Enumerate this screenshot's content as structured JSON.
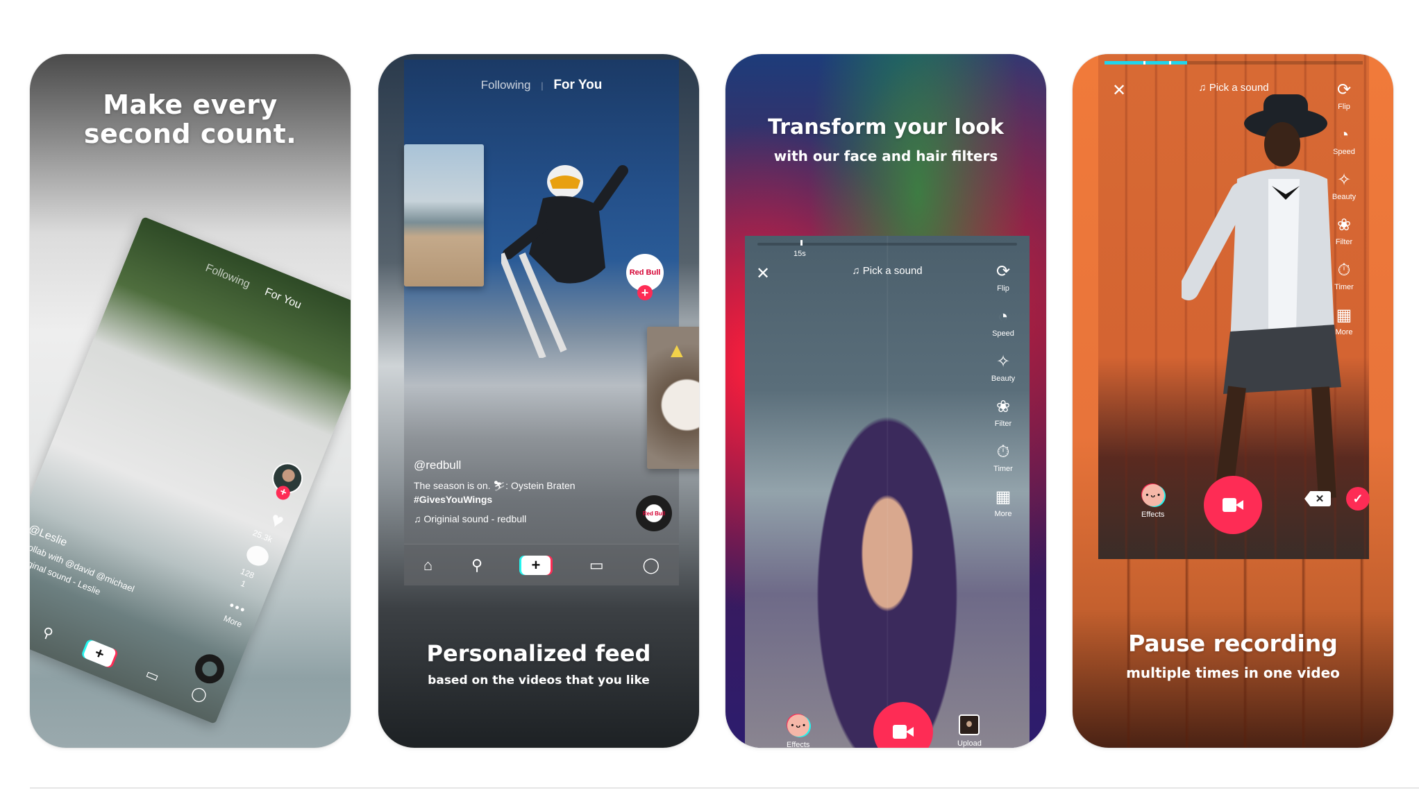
{
  "colors": {
    "accent_red": "#fe2c55",
    "accent_cyan": "#25f4ee",
    "progress_cyan": "#20d5ec",
    "divider": "#e5e5e5"
  },
  "screenshots": [
    {
      "headline": "Make every second count.",
      "headline_line1": "Make every",
      "headline_line2": "second count.",
      "card": {
        "tab_following": "Following",
        "tab_for_you": "For You",
        "like_count": "25.3k",
        "comment_count": "128",
        "share_count": "1",
        "more_label": "More",
        "username": "@Leslie",
        "description": "Collab with @david @michael",
        "sound": "Original sound - Leslie",
        "icons": [
          "home-icon",
          "search-icon",
          "create-icon",
          "inbox-icon",
          "profile-icon"
        ]
      }
    },
    {
      "headline": "Personalized feed",
      "subline": "based on the videos that you like",
      "feed": {
        "tab_following": "Following",
        "tab_separator": "|",
        "tab_for_you": "For You",
        "avatar_label": "Red Bull",
        "username": "@redbull",
        "description": "The season is on. ⛷: Oystein Braten",
        "hashtag": "#GivesYouWings",
        "sound": "Originial sound - redbull",
        "disc_label": "Red Bull",
        "icons": [
          "home-icon",
          "search-icon",
          "create-icon",
          "inbox-icon",
          "profile-icon"
        ]
      }
    },
    {
      "headline": "Transform your look",
      "subline": "with our face and hair filters",
      "camera": {
        "duration_label": "15s",
        "sound_label": "Pick a sound",
        "tools": [
          {
            "label": "Flip",
            "icon": "flip-icon",
            "glyph": "⟳"
          },
          {
            "label": "Speed",
            "icon": "speed-icon",
            "glyph": "◔"
          },
          {
            "label": "Beauty",
            "icon": "beauty-wand-icon",
            "glyph": "✧"
          },
          {
            "label": "Filter",
            "icon": "filter-icon",
            "glyph": "❀"
          },
          {
            "label": "Timer",
            "icon": "timer-icon",
            "glyph": "⏱"
          },
          {
            "label": "More",
            "icon": "more-grid-icon",
            "glyph": "▦"
          }
        ],
        "effects_label": "Effects",
        "upload_label": "Upload"
      }
    },
    {
      "headline": "Pause recording",
      "subline": "multiple times in one video",
      "camera": {
        "sound_label": "Pick a sound",
        "recorded_fraction": 0.32,
        "segment_marks": [
          0.15,
          0.25
        ],
        "tools": [
          {
            "label": "Flip",
            "icon": "flip-icon",
            "glyph": "⟳"
          },
          {
            "label": "Speed",
            "icon": "speed-icon",
            "glyph": "◔"
          },
          {
            "label": "Beauty",
            "icon": "beauty-wand-icon",
            "glyph": "✧"
          },
          {
            "label": "Filter",
            "icon": "filter-icon",
            "glyph": "❀"
          },
          {
            "label": "Timer",
            "icon": "timer-icon",
            "glyph": "⏱"
          },
          {
            "label": "More",
            "icon": "more-grid-icon",
            "glyph": "▦"
          }
        ],
        "effects_label": "Effects",
        "delete_glyph": "✕",
        "done_glyph": "✓"
      }
    }
  ]
}
